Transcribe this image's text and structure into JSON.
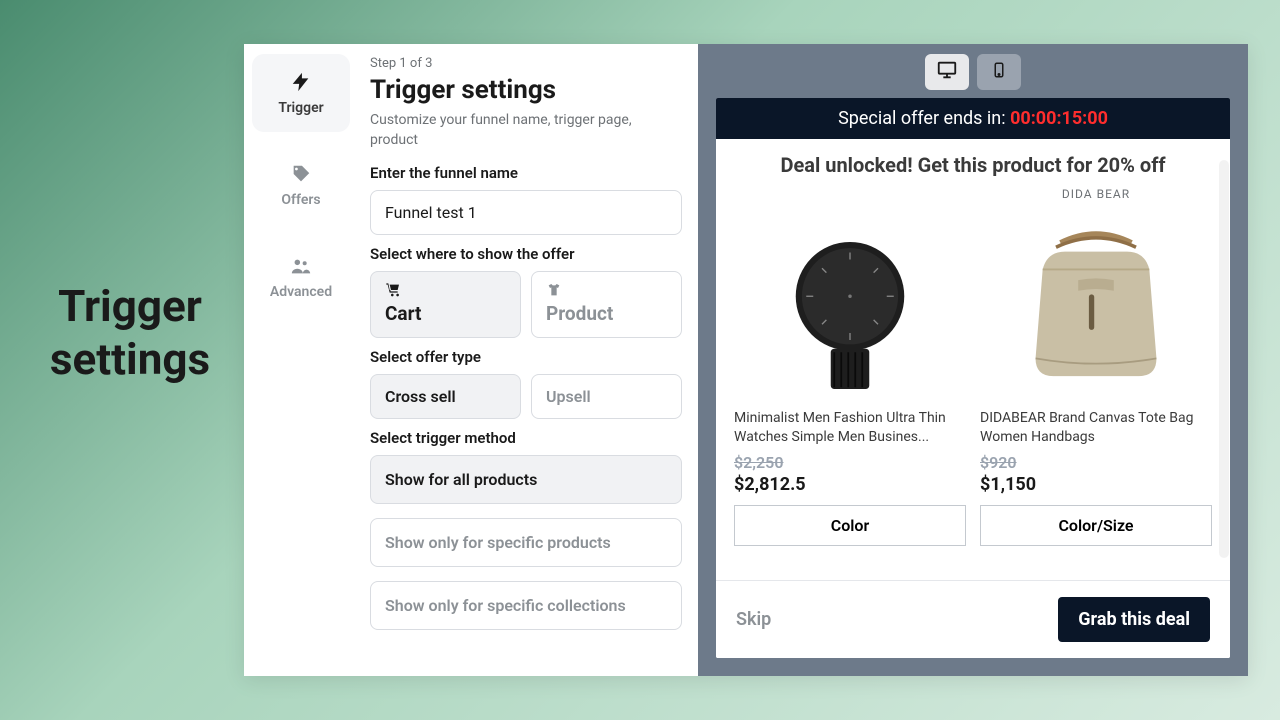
{
  "page_label": "Trigger settings",
  "sidebar": {
    "items": [
      {
        "id": "trigger",
        "label": "Trigger",
        "active": true
      },
      {
        "id": "offers",
        "label": "Offers",
        "active": false
      },
      {
        "id": "advanced",
        "label": "Advanced",
        "active": false
      }
    ]
  },
  "header": {
    "step": "Step 1 of 3",
    "title": "Trigger settings",
    "subtitle": "Customize your funnel name, trigger page, product"
  },
  "form": {
    "name_label": "Enter the funnel name",
    "name_value": "Funnel test 1",
    "where_label": "Select where to show the offer",
    "where_options": [
      {
        "id": "cart",
        "label": "Cart",
        "selected": true
      },
      {
        "id": "product",
        "label": "Product",
        "selected": false
      }
    ],
    "type_label": "Select offer type",
    "type_options": [
      {
        "id": "cross",
        "label": "Cross sell",
        "selected": true
      },
      {
        "id": "upsell",
        "label": "Upsell",
        "selected": false
      }
    ],
    "method_label": "Select trigger method",
    "method_options": [
      {
        "id": "all",
        "label": "Show for all products",
        "selected": true
      },
      {
        "id": "specific",
        "label": "Show only for specific products",
        "selected": false
      },
      {
        "id": "collections",
        "label": "Show only for specific collections",
        "selected": false
      }
    ]
  },
  "preview": {
    "device": "desktop",
    "banner_prefix": "Special offer ends in: ",
    "banner_timer": "00:00:15:00",
    "deal_text": "Deal unlocked! Get this product for 20% off",
    "products": [
      {
        "brand": "",
        "name": "Minimalist Men Fashion Ultra Thin Watches Simple Men Busines...",
        "old_price": "$2,250",
        "new_price": "$2,812.5",
        "variant": "Color"
      },
      {
        "brand": "DIDA BEAR",
        "name": "DIDABEAR Brand Canvas Tote Bag Women Handbags",
        "old_price": "$920",
        "new_price": "$1,150",
        "variant": "Color/Size"
      }
    ],
    "skip_label": "Skip",
    "cta_label": "Grab this deal"
  }
}
